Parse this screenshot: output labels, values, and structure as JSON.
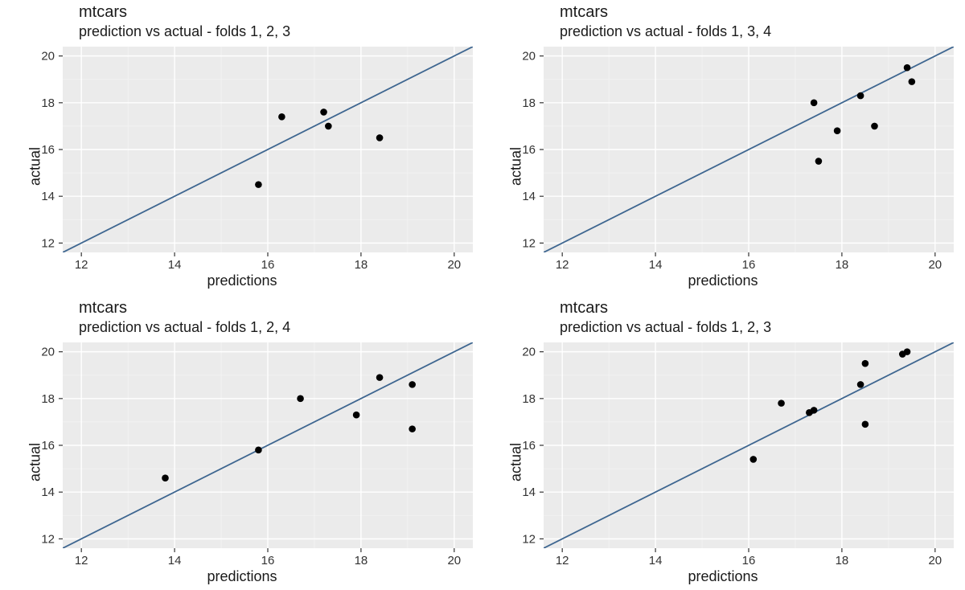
{
  "chart_data": [
    {
      "type": "scatter",
      "title": "mtcars",
      "subtitle": "prediction vs actual - folds 1, 2, 3",
      "xlabel": "predictions",
      "ylabel": "actual",
      "xlim": [
        11.6,
        20.4
      ],
      "ylim": [
        11.6,
        20.4
      ],
      "x_ticks": [
        12,
        14,
        16,
        18,
        20
      ],
      "y_ticks": [
        12,
        14,
        16,
        18,
        20
      ],
      "abline": {
        "slope": 1,
        "intercept": 0
      },
      "points": [
        {
          "x": 15.8,
          "y": 14.5
        },
        {
          "x": 16.3,
          "y": 17.4
        },
        {
          "x": 17.2,
          "y": 17.6
        },
        {
          "x": 17.3,
          "y": 17.0
        },
        {
          "x": 18.4,
          "y": 16.5
        }
      ]
    },
    {
      "type": "scatter",
      "title": "mtcars",
      "subtitle": "prediction vs actual - folds 1, 3, 4",
      "xlabel": "predictions",
      "ylabel": "actual",
      "xlim": [
        11.6,
        20.4
      ],
      "ylim": [
        11.6,
        20.4
      ],
      "x_ticks": [
        12,
        14,
        16,
        18,
        20
      ],
      "y_ticks": [
        12,
        14,
        16,
        18,
        20
      ],
      "abline": {
        "slope": 1,
        "intercept": 0
      },
      "points": [
        {
          "x": 17.4,
          "y": 18.0
        },
        {
          "x": 17.5,
          "y": 15.5
        },
        {
          "x": 17.9,
          "y": 16.8
        },
        {
          "x": 18.4,
          "y": 18.3
        },
        {
          "x": 18.7,
          "y": 17.0
        },
        {
          "x": 19.4,
          "y": 19.5
        },
        {
          "x": 19.5,
          "y": 18.9
        }
      ]
    },
    {
      "type": "scatter",
      "title": "mtcars",
      "subtitle": "prediction vs actual - folds 1, 2, 4",
      "xlabel": "predictions",
      "ylabel": "actual",
      "xlim": [
        11.6,
        20.4
      ],
      "ylim": [
        11.6,
        20.4
      ],
      "x_ticks": [
        12,
        14,
        16,
        18,
        20
      ],
      "y_ticks": [
        12,
        14,
        16,
        18,
        20
      ],
      "abline": {
        "slope": 1,
        "intercept": 0
      },
      "points": [
        {
          "x": 13.8,
          "y": 14.6
        },
        {
          "x": 15.8,
          "y": 15.8
        },
        {
          "x": 16.7,
          "y": 18.0
        },
        {
          "x": 17.9,
          "y": 17.3
        },
        {
          "x": 18.4,
          "y": 18.9
        },
        {
          "x": 19.1,
          "y": 18.6
        },
        {
          "x": 19.1,
          "y": 16.7
        }
      ]
    },
    {
      "type": "scatter",
      "title": "mtcars",
      "subtitle": "prediction vs actual - folds 1, 2, 3",
      "xlabel": "predictions",
      "ylabel": "actual",
      "xlim": [
        11.6,
        20.4
      ],
      "ylim": [
        11.6,
        20.4
      ],
      "x_ticks": [
        12,
        14,
        16,
        18,
        20
      ],
      "y_ticks": [
        12,
        14,
        16,
        18,
        20
      ],
      "abline": {
        "slope": 1,
        "intercept": 0
      },
      "points": [
        {
          "x": 16.1,
          "y": 15.4
        },
        {
          "x": 16.7,
          "y": 17.8
        },
        {
          "x": 17.3,
          "y": 17.4
        },
        {
          "x": 17.4,
          "y": 17.5
        },
        {
          "x": 18.4,
          "y": 18.6
        },
        {
          "x": 18.5,
          "y": 19.5
        },
        {
          "x": 18.5,
          "y": 16.9
        },
        {
          "x": 19.3,
          "y": 19.9
        },
        {
          "x": 19.4,
          "y": 20.0
        }
      ]
    }
  ]
}
